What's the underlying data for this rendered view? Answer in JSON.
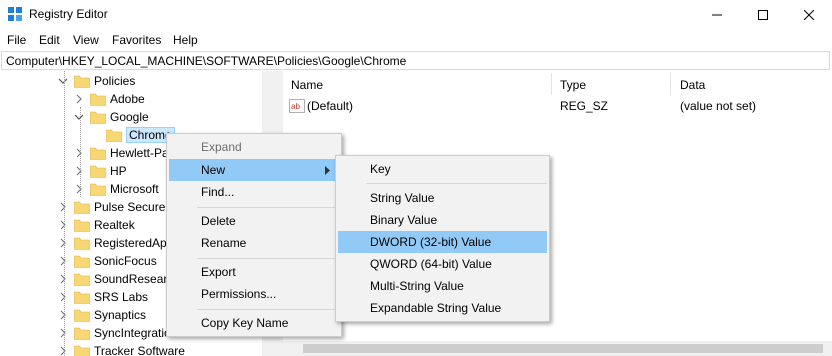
{
  "window": {
    "title": "Registry Editor"
  },
  "menubar": [
    "File",
    "Edit",
    "View",
    "Favorites",
    "Help"
  ],
  "address": "Computer\\HKEY_LOCAL_MACHINE\\SOFTWARE\\Policies\\Google\\Chrome",
  "tree": [
    {
      "label": "Policies",
      "expanded": true
    },
    {
      "label": "Adobe",
      "expanded": false
    },
    {
      "label": "Google",
      "expanded": true
    },
    {
      "label": "Chrome",
      "selected": true
    },
    {
      "label": "Hewlett-Pa",
      "expanded": false
    },
    {
      "label": "HP",
      "expanded": false
    },
    {
      "label": "Microsoft",
      "expanded": false
    },
    {
      "label": "Pulse Secure",
      "expanded": false
    },
    {
      "label": "Realtek",
      "expanded": false
    },
    {
      "label": "RegisteredApp",
      "expanded": false
    },
    {
      "label": "SonicFocus",
      "expanded": false
    },
    {
      "label": "SoundResearc",
      "expanded": false
    },
    {
      "label": "SRS Labs",
      "expanded": false
    },
    {
      "label": "Synaptics",
      "expanded": false
    },
    {
      "label": "SyncIntegrationClients",
      "expanded": false
    },
    {
      "label": "Tracker Software",
      "expanded": false
    }
  ],
  "list": {
    "columns": [
      "Name",
      "Type",
      "Data"
    ],
    "rows": [
      {
        "name": "(Default)",
        "type": "REG_SZ",
        "data": "(value not set)",
        "icon": "string-value-icon"
      }
    ]
  },
  "context_menu": {
    "items": [
      "Expand",
      "New",
      "Find...",
      "Delete",
      "Rename",
      "Export",
      "Permissions...",
      "Copy Key Name"
    ]
  },
  "new_submenu": {
    "items": [
      "Key",
      "String Value",
      "Binary Value",
      "DWORD (32-bit) Value",
      "QWORD (64-bit) Value",
      "Multi-String Value",
      "Expandable String Value"
    ],
    "highlighted": "DWORD (32-bit) Value"
  },
  "colors": {
    "highlight": "#91c9f7",
    "selection": "#cce8ff",
    "folder": "#f8d775"
  }
}
